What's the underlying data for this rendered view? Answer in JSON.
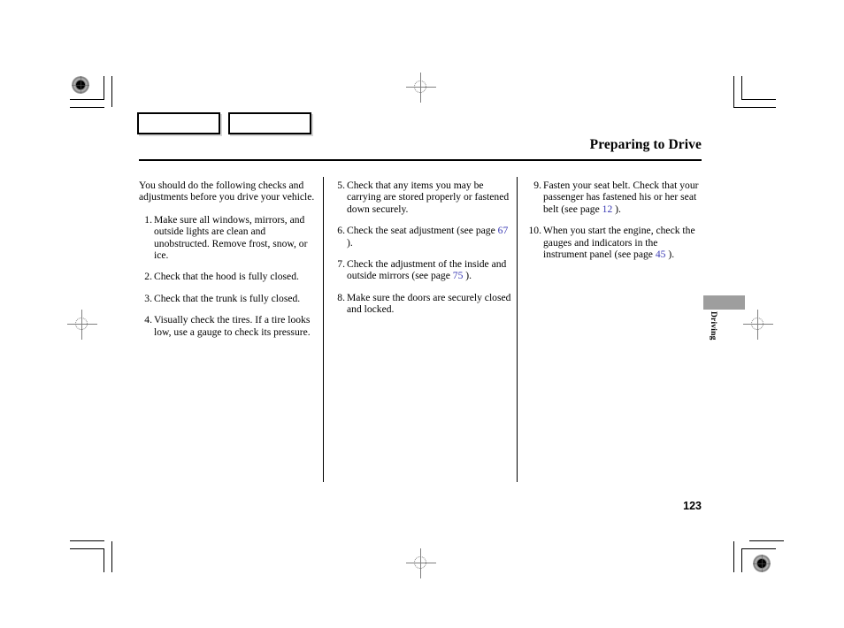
{
  "page": {
    "header_title": "Preparing to Drive",
    "page_number": "123",
    "thumb_tab_label": "Driving",
    "accent_link_color": "#3a3ab4",
    "thumb_tab_color": "#9e9e9e"
  },
  "columns": {
    "left": {
      "intro": "You should do the following checks and adjustments before you drive your vehicle.",
      "steps": [
        {
          "num": "1.",
          "text": "Make sure all windows, mirrors, and outside lights are clean and unobstructed. Remove frost, snow, or ice."
        },
        {
          "num": "2.",
          "text": "Check that the hood is fully closed."
        },
        {
          "num": "3.",
          "text": "Check that the trunk is fully closed."
        },
        {
          "num": "4.",
          "text": "Visually check the tires. If a tire looks low, use a gauge to check its pressure."
        }
      ]
    },
    "middle": {
      "steps": [
        {
          "num": "5.",
          "text": "Check that any items you may be carrying are stored properly or fastened down securely."
        },
        {
          "num": "6.",
          "text_before": "Check the seat adjustment (see page",
          "page_ref": "67",
          "text_after": ")."
        },
        {
          "num": "7.",
          "text_before": "Check the adjustment of the inside and outside mirrors (see page",
          "page_ref": "75",
          "text_after": ")."
        },
        {
          "num": "8.",
          "text": "Make sure the doors are securely closed and locked."
        }
      ]
    },
    "right": {
      "steps": [
        {
          "num": "9.",
          "text_before": "Fasten your seat belt. Check that your passenger has fastened his or her seat belt (see page",
          "page_ref": "12",
          "text_after": ")."
        },
        {
          "num": "10.",
          "text_before": "When you start the engine, check the gauges and indicators in the instrument panel (see page",
          "page_ref": "45",
          "text_after": ")."
        }
      ]
    }
  },
  "print_marks": {
    "color_box_1_label": "",
    "color_box_2_label": ""
  }
}
